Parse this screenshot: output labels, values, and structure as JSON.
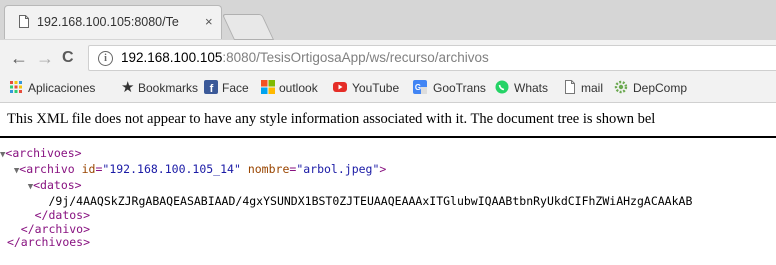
{
  "tab": {
    "title": "192.168.100.105:8080/Te",
    "close_label": "×"
  },
  "toolbar": {
    "back_label": "←",
    "forward_label": "→",
    "reload_label": "C"
  },
  "address": {
    "host": "192.168.100.105",
    "rest": ":8080/TesisOrtigosaApp/ws/recurso/archivos"
  },
  "bookmarks": {
    "items": [
      {
        "label": "Aplicaciones",
        "icon": "apps-grid-icon",
        "color": "#e74c3c"
      },
      {
        "label": "Bookmarks",
        "icon": "star-icon",
        "color": "#333333"
      },
      {
        "label": "Face",
        "icon": "facebook-icon",
        "color": "#3b5998"
      },
      {
        "label": "outlook",
        "icon": "microsoft-icon",
        "color": "#f25022"
      },
      {
        "label": "YouTube",
        "icon": "youtube-icon",
        "color": "#e52d27"
      },
      {
        "label": "GooTrans",
        "icon": "google-translate-icon",
        "color": "#4285f4"
      },
      {
        "label": "Whats",
        "icon": "whatsapp-icon",
        "color": "#25d366"
      },
      {
        "label": "mail",
        "icon": "page-icon",
        "color": "#777777"
      },
      {
        "label": "DepComp",
        "icon": "gear-icon",
        "color": "#6aa84f"
      }
    ]
  },
  "page": {
    "notice": "This XML file does not appear to have any style information associated with it. The document tree is shown bel"
  },
  "xml": {
    "root_open": "<archivoes>",
    "archivo_tag_open": "<archivo",
    "attr_id_name": "id",
    "attr_id_value": "\"192.168.100.105_14\"",
    "attr_nombre_name": "nombre",
    "attr_nombre_value": "\"arbol.jpeg\"",
    "archivo_tag_close_bracket": ">",
    "datos_open": "<datos>",
    "datos_text": "/9j/4AAQSkZJRgABAQEASABIAAD/4gxYSUNDX1BST0ZJTEUAAQEAAAxITGlubwIQAABtbnRyUkdCIFhZWiAHzgACAAkAB",
    "datos_close": "</datos>",
    "archivo_close": "</archivo>",
    "root_close": "</archivoes>"
  }
}
